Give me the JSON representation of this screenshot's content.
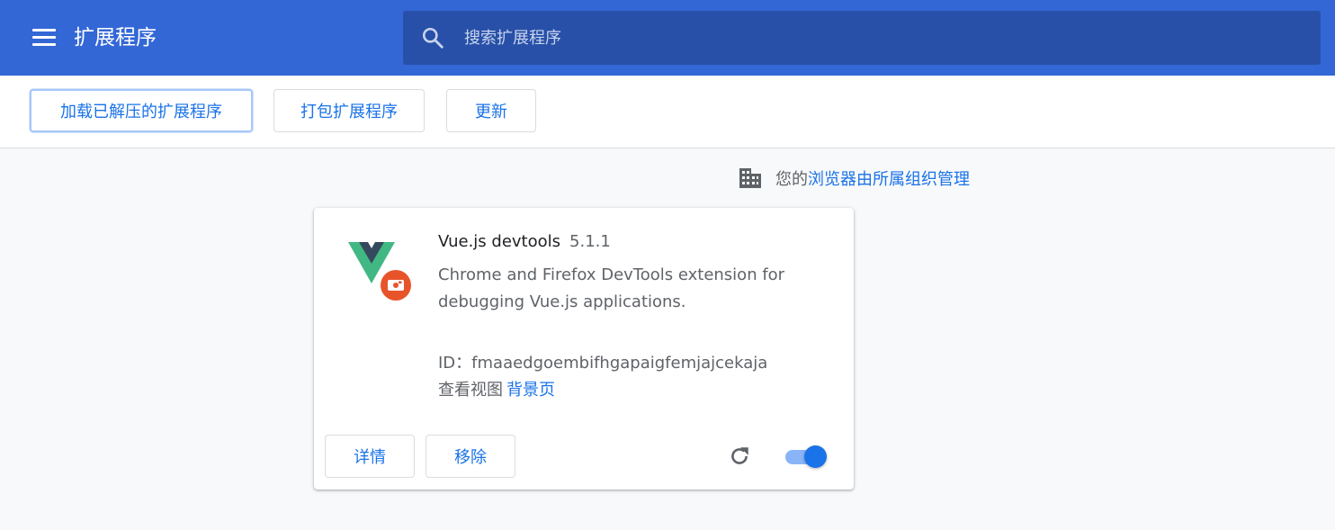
{
  "header": {
    "title": "扩展程序",
    "search_placeholder": "搜索扩展程序",
    "icons": {
      "menu": "hamburger-menu-icon",
      "search": "search-icon"
    }
  },
  "toolbar": {
    "load_unpacked_label": "加载已解压的扩展程序",
    "pack_label": "打包扩展程序",
    "update_label": "更新"
  },
  "managed_notice": {
    "prefix": "您的",
    "link": "浏览器由所属组织管理",
    "icon": "building-icon"
  },
  "extension": {
    "name": "Vue.js devtools",
    "version": "5.1.1",
    "description": "Chrome and Firefox DevTools extension for debugging Vue.js applications.",
    "id_label": "ID：",
    "id_value": "fmaaedgoembifhgapaigfemjajcekaja",
    "views_label": "查看视图",
    "views_link": "背景页",
    "details_label": "详情",
    "remove_label": "移除",
    "enabled": true,
    "icon": "vue-logo-icon"
  },
  "colors": {
    "header_bg": "#3367d6",
    "search_bg": "#2850a8",
    "accent": "#1a73e8",
    "page_bg": "#f8f9fa",
    "vue_green": "#41b883",
    "vue_dark": "#34495e",
    "badge_orange": "#e8542a"
  }
}
